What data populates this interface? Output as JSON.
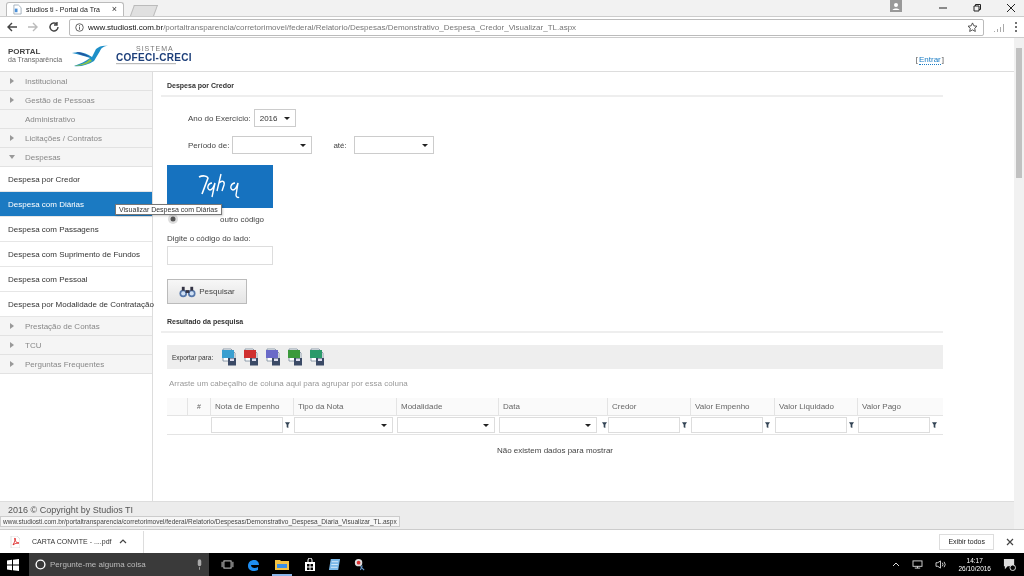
{
  "browser": {
    "tabs": [
      {
        "title": "studios ti - Portal da Tra",
        "selected": true
      },
      {
        "selected": false
      }
    ],
    "tab_close": "×",
    "url": {
      "host": "www.studiosti.com.br",
      "path": "/portaltransparencia/corretorimovel/federal/Relatorio/Despesas/Demonstrativo_Despesa_Credor_Visualizar_TL.aspx"
    },
    "status_url": "www.studiosti.com.br/portaltransparencia/corretorimovel/federal/Relatorio/Despesas/Demonstrativo_Despesa_Diaria_Visualizar_TL.aspx"
  },
  "header": {
    "portal": "PORTAL",
    "portal_sub": "da Transparência",
    "logo_small": "SISTEMA",
    "logo": "COFECI-CRECI",
    "login": "Entrar",
    "login_open": "[",
    "login_close": "]"
  },
  "sidebar": {
    "items": [
      {
        "label": "Institucional",
        "kind": "group",
        "expanded": false
      },
      {
        "label": "Gestão de Pessoas",
        "kind": "group",
        "expanded": false
      },
      {
        "label": "Administrativo",
        "kind": "leaf"
      },
      {
        "label": "Licitações / Contratos",
        "kind": "group",
        "expanded": false
      },
      {
        "label": "Despesas",
        "kind": "group",
        "expanded": true,
        "children": [
          {
            "label": "Despesa por Credor",
            "selected": false
          },
          {
            "label": "Despesa com Diárias",
            "selected": true
          },
          {
            "label": "Despesa com Passagens",
            "selected": false
          },
          {
            "label": "Despesa com Suprimento de Fundos",
            "selected": false
          },
          {
            "label": "Despesa com Pessoal",
            "selected": false
          },
          {
            "label": "Despesa por Modalidade de Contratação",
            "selected": false
          }
        ]
      },
      {
        "label": "Prestação de Contas",
        "kind": "group",
        "expanded": false
      },
      {
        "label": "TCU",
        "kind": "group",
        "expanded": false
      },
      {
        "label": "Perguntas Frequentes",
        "kind": "group",
        "expanded": false
      }
    ]
  },
  "tooltip": "Visualizar Despesa com Diárias",
  "main": {
    "title": "Despesa por Credor",
    "year": {
      "label": "Ano do Exercício:",
      "value": "2016"
    },
    "period": {
      "label": "Período de:",
      "to_label": "até:"
    },
    "captcha": {
      "refresh": "outro código",
      "code_label": "Digite o código do lado:"
    },
    "search_button": "Pesquisar",
    "results_title": "Resultado da pesquisa",
    "export": {
      "label": "Exportar para:",
      "formats": [
        {
          "color": "#3a9fd0"
        },
        {
          "color": "#d03030"
        },
        {
          "color": "#6a6ac8"
        },
        {
          "color": "#3c9a3c"
        },
        {
          "color": "#2a9a6a"
        }
      ]
    },
    "group_hint": "Arraste um cabeçalho de coluna aqui para agrupar por essa coluna",
    "columns": [
      {
        "kind": "none"
      },
      {
        "label": "#",
        "kind": "none"
      },
      {
        "label": "Nota de Empenho",
        "kind": "text"
      },
      {
        "label": "Tipo da Nota",
        "kind": "select"
      },
      {
        "label": "Modalidade",
        "kind": "select"
      },
      {
        "label": "Data",
        "kind": "select_filter"
      },
      {
        "label": "Credor",
        "kind": "text"
      },
      {
        "label": "Valor Empenho",
        "kind": "text"
      },
      {
        "label": "Valor Liquidado",
        "kind": "text"
      },
      {
        "label": "Valor Pago",
        "kind": "text"
      }
    ],
    "empty_message": "Não existem dados para mostrar"
  },
  "footer": "2016 © Copyright by Studios TI",
  "downloads": {
    "file": "CARTA CONVITE - ....pdf",
    "show_all": "Exibir todos"
  },
  "taskbar": {
    "search_placeholder": "Pergunte-me alguma coisa",
    "time": "14:17",
    "date": "26/10/2016"
  }
}
